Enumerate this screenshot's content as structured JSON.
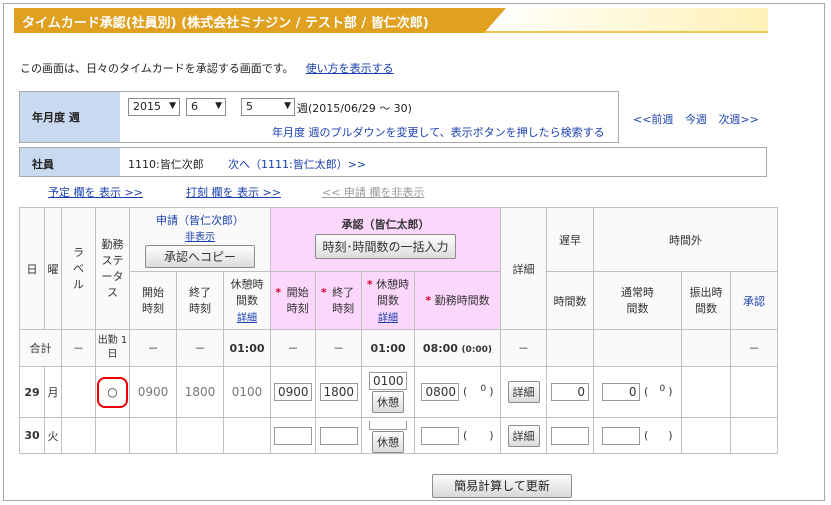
{
  "title": "タイムカード承認(社員別) (株式会社ミナジン / テスト部 / 皆仁次郎)",
  "intro": {
    "text": "この画面は、日々のタイムカードを承認する画面です。",
    "help_link": "使い方を表示する"
  },
  "period": {
    "label": "年月度 週",
    "year": "2015",
    "month": "6",
    "week": "5",
    "week_suffix": "週(2015/06/29 ～ 30)",
    "hint": "年月度 週のプルダウンを変更して、表示ボタンを押したら検索する",
    "prev": "<<前週",
    "current": "今週",
    "next": "次週>>"
  },
  "employee": {
    "label": "社員",
    "value": "1110:皆仁次郎",
    "next": "次へ（1111:皆仁太郎）>>"
  },
  "toggles": {
    "plan": "予定 欄を 表示 >>",
    "stamp": "打刻 欄を 表示 >>",
    "request": "<< 申請 欄を非表示"
  },
  "header": {
    "day": "日",
    "weekday": "曜",
    "label": "ラベル",
    "status": "勤務ステータス",
    "request_title": "申請（皆仁次郎）",
    "hide": "非表示",
    "copy_button": "承認へコピー",
    "req_start": "開始時刻",
    "req_end": "終了時刻",
    "req_break": "休憩時間数",
    "detail_link": "詳細",
    "approval_title": "承認（皆仁太郎）",
    "bulk_button": "時刻･時間数の一括入力",
    "ap_start": "開始時刻",
    "ap_end": "終了時刻",
    "ap_break": "休憩時間数",
    "ap_work": "勤務時間数",
    "detail": "詳細",
    "late": "遅早",
    "late_sub": "時間数",
    "overtime": "時間外",
    "ot_normal": "通常時間数",
    "ot_transfer": "振出時間数",
    "ot_approve": "承認"
  },
  "totals": {
    "label": "合計",
    "labelcol": "－",
    "status": "出勤 1日",
    "req_start": "－",
    "req_end": "－",
    "req_break": "01:00",
    "ap_start": "－",
    "ap_end": "－",
    "ap_break": "01:00",
    "ap_work": "08:00",
    "ap_work_sub": "(0:00)",
    "detail": "－",
    "ot_approve": "－"
  },
  "rows": [
    {
      "day": "29",
      "weekday": "月",
      "status": "○",
      "req_start": "0900",
      "req_end": "1800",
      "req_break": "0100",
      "ap_start": "0900",
      "ap_end": "1800",
      "ap_break": "0100",
      "break_button": "休憩",
      "ap_work": "0800",
      "paren_open": "(",
      "paren_val": "0",
      "paren_close": ")",
      "detail_button": "詳細",
      "late": "0",
      "ot_normal": "0",
      "ot_paren_open": "(",
      "ot_paren_val": "0",
      "ot_paren_close": ")"
    },
    {
      "day": "30",
      "weekday": "火",
      "status": "",
      "req_start": "",
      "req_end": "",
      "req_break": "",
      "ap_start": "",
      "ap_end": "",
      "ap_break": "",
      "break_button": "休憩",
      "ap_work": "",
      "paren_open": "(",
      "paren_val": "",
      "paren_close": ")",
      "detail_button": "詳細",
      "late": "",
      "ot_normal": "",
      "ot_paren_open": "(",
      "ot_paren_val": "",
      "ot_paren_close": ")"
    }
  ],
  "footer_button": "簡易計算して更新"
}
